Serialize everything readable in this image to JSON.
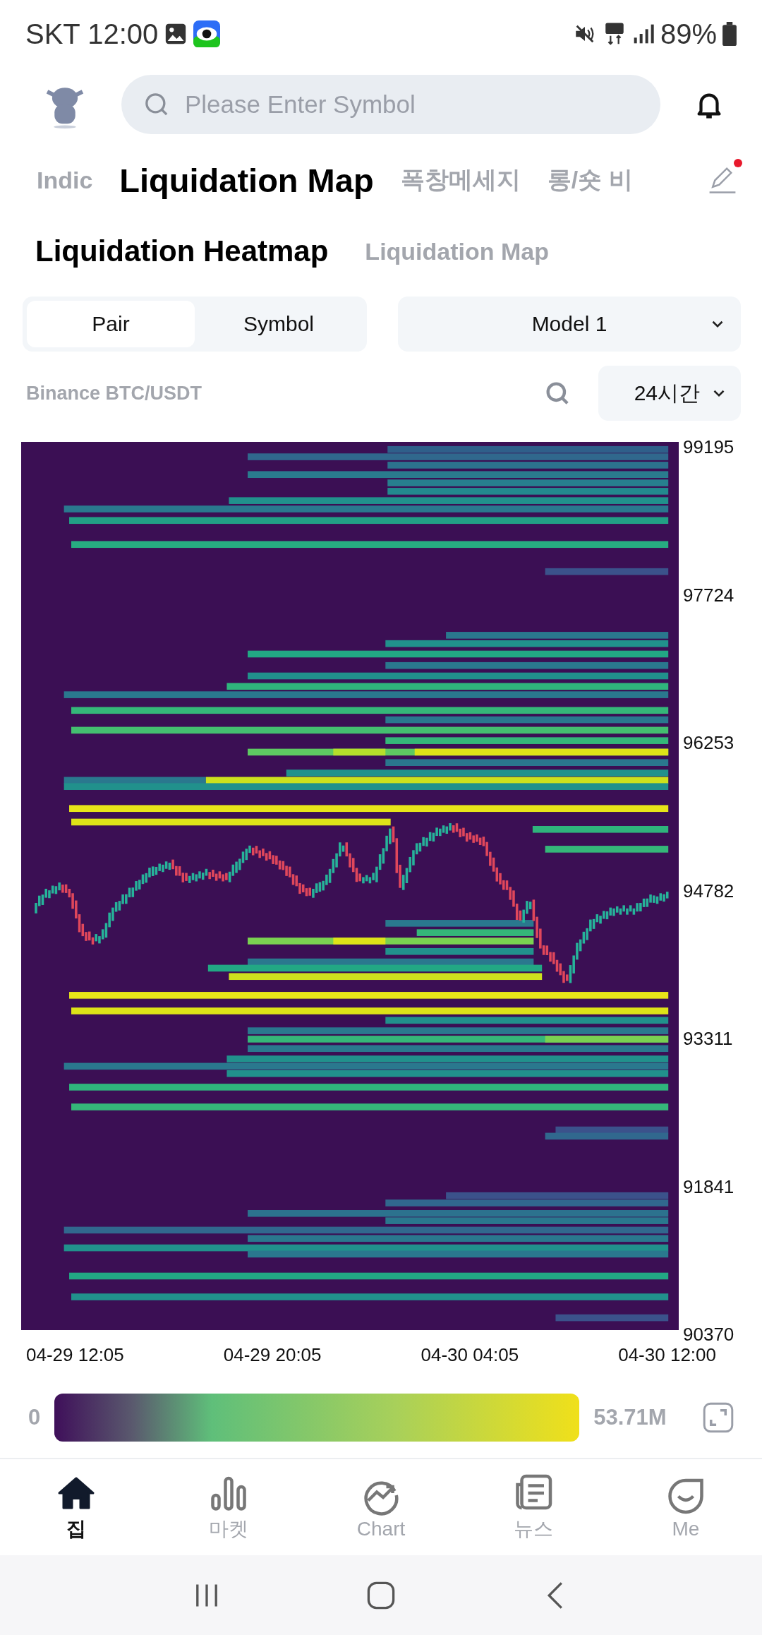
{
  "status_bar": {
    "carrier": "SKT",
    "time": "12:00",
    "battery": "89%"
  },
  "search": {
    "placeholder": "Please Enter Symbol"
  },
  "top_tabs": [
    {
      "label": "Indic",
      "selected": false
    },
    {
      "label": "Liquidation Map",
      "selected": true
    },
    {
      "label": "폭창메세지",
      "selected": false
    },
    {
      "label": "롱/숏 비",
      "selected": false
    }
  ],
  "edit_button": {
    "has_dot": true
  },
  "sub_tabs": [
    {
      "label": "Liquidation Heatmap",
      "selected": true
    },
    {
      "label": "Liquidation Map",
      "selected": false
    }
  ],
  "segment": [
    {
      "label": "Pair",
      "selected": true
    },
    {
      "label": "Symbol",
      "selected": false
    }
  ],
  "model_dropdown": {
    "value": "Model 1"
  },
  "market": "Binance BTC/USDT",
  "range_dropdown": {
    "value": "24시간"
  },
  "heatmap": {
    "kind": "picture",
    "y_labels": [
      "99195",
      "97724",
      "96253",
      "94782",
      "93311",
      "91841",
      "90370"
    ],
    "x_labels": [
      "04-29 12:05",
      "04-29 20:05",
      "04-30 04:05",
      "04-30 12:00"
    ]
  },
  "legend": {
    "min": "0",
    "max": "53.71M"
  },
  "bottom_nav": [
    {
      "label": "집",
      "selected": true
    },
    {
      "label": "마켓",
      "selected": false
    },
    {
      "label": "Chart",
      "selected": false
    },
    {
      "label": "뉴스",
      "selected": false
    },
    {
      "label": "Me",
      "selected": false
    }
  ]
}
